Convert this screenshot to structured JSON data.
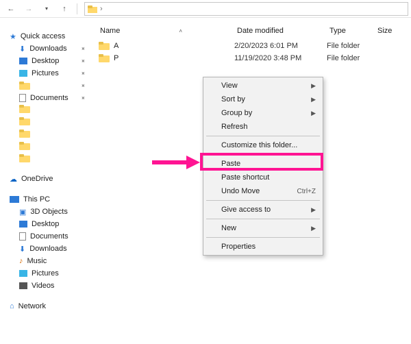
{
  "toolbar": {
    "back": "←",
    "forward": "→",
    "up": "↑",
    "address_chevron": "›"
  },
  "columns": {
    "name": "Name",
    "date": "Date modified",
    "type": "Type",
    "size": "Size"
  },
  "sidebar": {
    "quick_access": {
      "label": "Quick access",
      "icon": "star-icon"
    },
    "downloads": {
      "label": "Downloads",
      "icon": "download-icon"
    },
    "desktop": {
      "label": "Desktop",
      "icon": "desktop-icon"
    },
    "pictures": {
      "label": "Pictures",
      "icon": "pictures-icon"
    },
    "documents_pin": {
      "label": "Documents",
      "icon": "documents-icon"
    },
    "onedrive": {
      "label": "OneDrive",
      "icon": "cloud-icon"
    },
    "this_pc": {
      "label": "This PC",
      "icon": "monitor-icon"
    },
    "objects3d": {
      "label": "3D Objects",
      "icon": "cube-icon"
    },
    "desktop2": {
      "label": "Desktop",
      "icon": "desktop-icon"
    },
    "documents2": {
      "label": "Documents",
      "icon": "documents-icon"
    },
    "downloads2": {
      "label": "Downloads",
      "icon": "download-icon"
    },
    "music": {
      "label": "Music",
      "icon": "music-icon"
    },
    "pictures2": {
      "label": "Pictures",
      "icon": "pictures-icon"
    },
    "videos": {
      "label": "Videos",
      "icon": "videos-icon"
    },
    "network": {
      "label": "Network",
      "icon": "network-icon"
    }
  },
  "files": [
    {
      "name": "A",
      "date": "2/20/2023 6:01 PM",
      "type": "File folder"
    },
    {
      "name": "P",
      "date": "11/19/2020 3:48 PM",
      "type": "File folder"
    }
  ],
  "context_menu": {
    "view": {
      "label": "View",
      "sub": true
    },
    "sort": {
      "label": "Sort by",
      "sub": true
    },
    "group": {
      "label": "Group by",
      "sub": true
    },
    "refresh": {
      "label": "Refresh"
    },
    "customize": {
      "label": "Customize this folder..."
    },
    "paste": {
      "label": "Paste"
    },
    "paste_short": {
      "label": "Paste shortcut"
    },
    "undo": {
      "label": "Undo Move",
      "shortcut": "Ctrl+Z"
    },
    "give_access": {
      "label": "Give access to",
      "sub": true
    },
    "new": {
      "label": "New",
      "sub": true
    },
    "properties": {
      "label": "Properties"
    }
  },
  "colors": {
    "accent": "#ff1493",
    "folder_fill": "#ffd86b",
    "folder_tab": "#e8bf49"
  }
}
